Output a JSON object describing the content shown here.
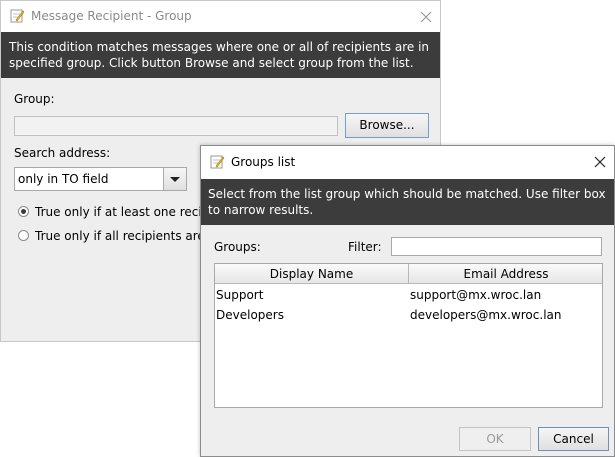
{
  "main_dialog": {
    "title": "Message Recipient - Group",
    "description": "This condition matches messages where one or all of recipients are in specified group. Click button Browse and select group from the list.",
    "group_label": "Group:",
    "group_value": "",
    "browse_button": "Browse...",
    "search_address_label": "Search address:",
    "search_address_value": "only in TO field",
    "radio_one": "True only if at least one recipie",
    "radio_all": "True only if all recipients are m",
    "selected_radio": "radio_one"
  },
  "groups_dialog": {
    "title": "Groups list",
    "description": "Select from the list group which should be matched. Use filter box to narrow results.",
    "groups_label": "Groups:",
    "filter_label": "Filter:",
    "filter_value": "",
    "columns": [
      "Display Name",
      "Email Address"
    ],
    "rows": [
      {
        "name": "Support",
        "email": "support@mx.wroc.lan"
      },
      {
        "name": "Developers",
        "email": "developers@mx.wroc.lan"
      }
    ],
    "ok_button": "OK",
    "cancel_button": "Cancel"
  }
}
